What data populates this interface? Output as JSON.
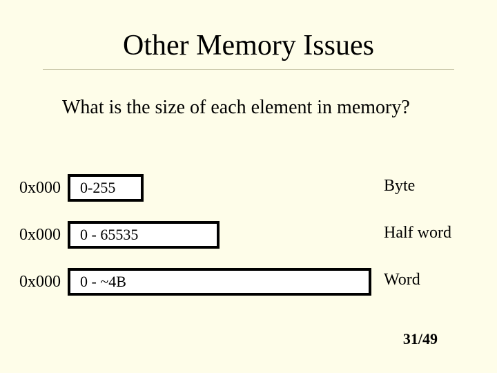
{
  "slide": {
    "title": "Other Memory Issues",
    "question": "What is the size of each element in memory?",
    "rows": [
      {
        "addr": "0x000",
        "range": "0-255",
        "type": "Byte"
      },
      {
        "addr": "0x000",
        "range": "0 - 65535",
        "type": "Half word"
      },
      {
        "addr": "0x000",
        "range": "0 - ~4B",
        "type": "Word"
      }
    ],
    "page": "31/49"
  }
}
